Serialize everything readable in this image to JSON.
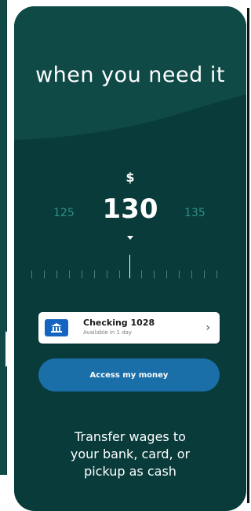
{
  "hero": {
    "title": "when you need it"
  },
  "amount_picker": {
    "currency": "$",
    "value": "130",
    "prev_value": "125",
    "next_value": "135"
  },
  "account": {
    "name": "Checking 1028",
    "subtitle": "Available in 1 day",
    "icon": "bank-icon"
  },
  "cta": {
    "label": "Access my money"
  },
  "footer": {
    "text": "Transfer wages to\nyour bank, card, or\npickup as cash"
  },
  "colors": {
    "background": "#083b3a",
    "hero": "#0f4a47",
    "button": "#1a6fa9",
    "accent_number": "#2f8f84",
    "bank_icon": "#1565c0"
  }
}
